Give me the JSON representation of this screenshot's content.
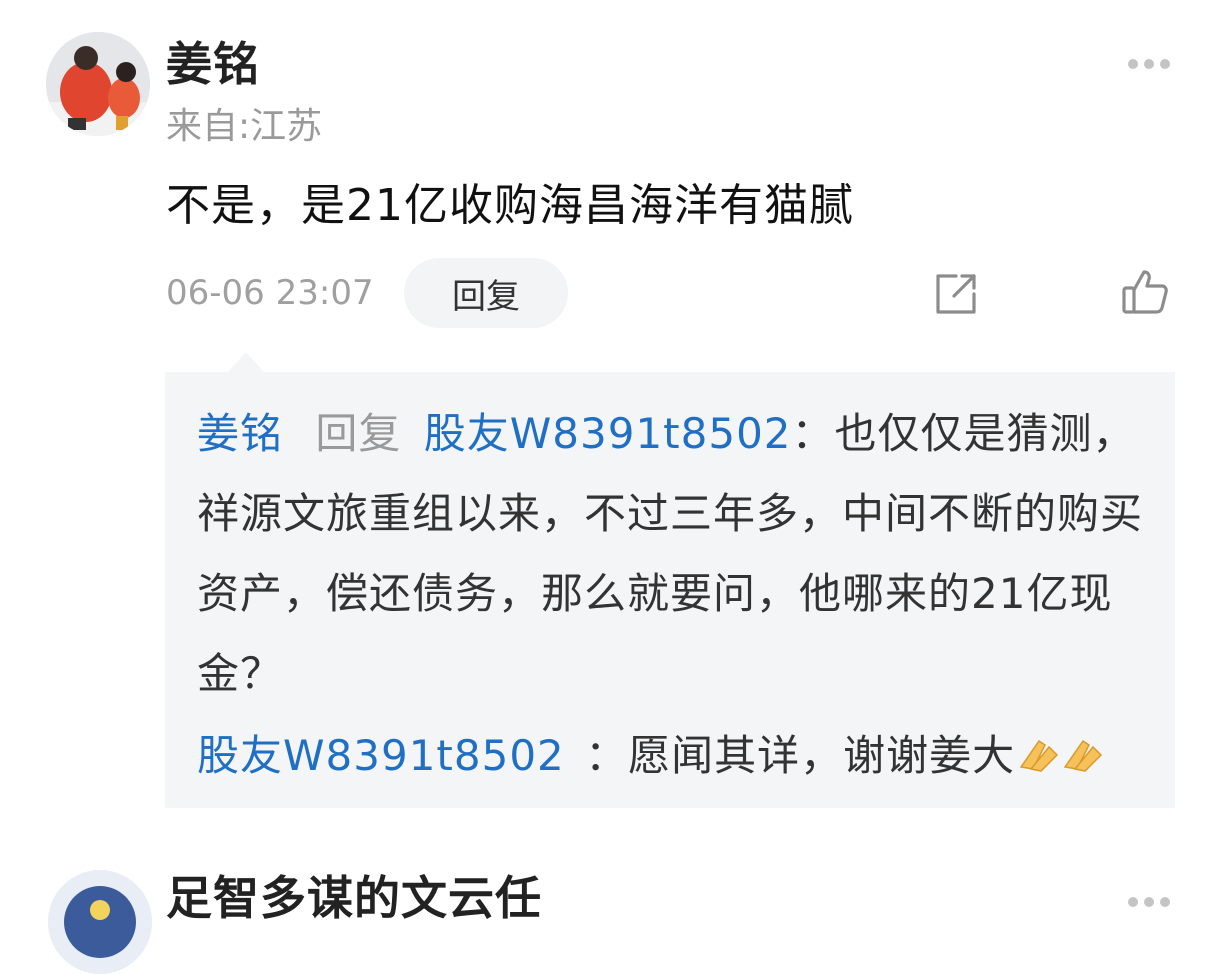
{
  "comment": {
    "username": "姜铭",
    "location": "来自:江苏",
    "text": "不是，是21亿收购海昌海洋有猫腻",
    "timestamp": "06-06 23:07",
    "reply_label": "回复",
    "icons": {
      "more": "more-dots-icon",
      "share": "share-icon",
      "like": "thumbs-up-icon"
    }
  },
  "replies": [
    {
      "author": "姜铭",
      "verb": "回复",
      "target": "股友W8391t8502",
      "separator": "：",
      "text": "也仅仅是猜测，祥源文旅重组以来，不过三年多，中间不断的购买资产，偿还债务，那么就要问，他哪来的21亿现金？"
    },
    {
      "author": "股友W8391t8502",
      "separator": " ：",
      "text": "愿闻其详，谢谢姜大"
    }
  ],
  "next_comment": {
    "username": "足智多谋的文云任"
  },
  "colors": {
    "link_blue": "#1f6fc5",
    "meta_grey": "#9a9a9a",
    "reply_bg": "#f4f5f7"
  }
}
